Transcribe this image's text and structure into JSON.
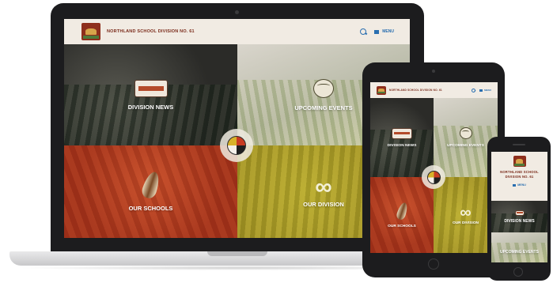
{
  "site": {
    "name": "NORTHLAND SCHOOL DIVISION NO. 61",
    "menu_label": "MENU"
  },
  "tiles": {
    "news": "DIVISION NEWS",
    "events": "UPCOMING EVENTS",
    "schools": "OUR SCHOOLS",
    "division": "OUR DIVISION"
  },
  "icons": {
    "logo": "school-division-logo-icon",
    "search": "search-icon",
    "menu": "hamburger-menu-icon",
    "news": "hand-drum-icon",
    "events": "woven-basket-icon",
    "schools": "feather-icon",
    "division": "infinity-icon",
    "center": "medicine-wheel-icon"
  },
  "colors": {
    "header_bg": "#f1ebe3",
    "title": "#7a2a1a",
    "accent_blue": "#2a6fb0",
    "news_tile": "#3a3a35",
    "events_tile": "#c9c7b6",
    "schools_tile": "#b83f22",
    "division_tile": "#aa9a28"
  }
}
